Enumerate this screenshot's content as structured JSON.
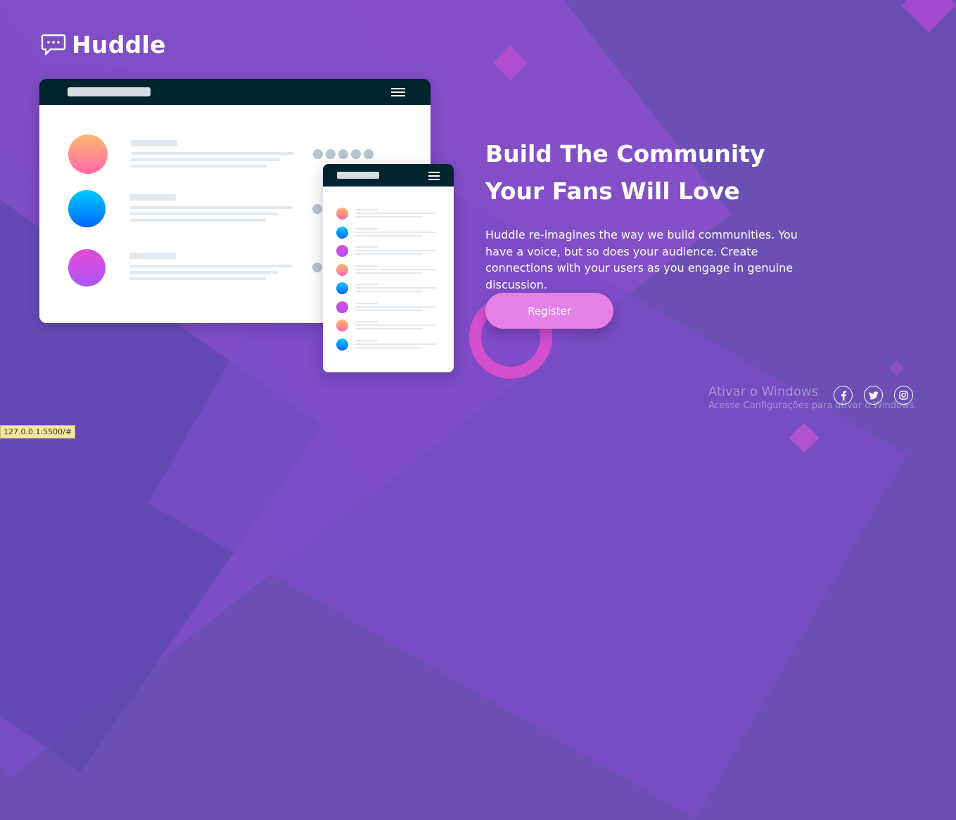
{
  "brand": {
    "name": "Huddle",
    "logo_icon": "chat-bubble-icon"
  },
  "hero": {
    "title_line1": "Build The Community",
    "title_line2": "Your Fans Will Love",
    "description": "Huddle re-imagines the way we build communities. You have a voice, but so does your audience. Create connections with your users as you engage in genuine discussion.",
    "cta_label": "Register"
  },
  "social": [
    {
      "name": "facebook-icon"
    },
    {
      "name": "twitter-icon"
    },
    {
      "name": "instagram-icon"
    }
  ],
  "watermark": {
    "line1": "Ativar o Windows",
    "line2": "Acesse Configurações para ativar o Windows."
  },
  "statusbar": {
    "url": "127.0.0.1:5500/#"
  },
  "colors": {
    "background": "#6B4FB4",
    "button": "#E581E6",
    "mock_bar": "#00252E"
  }
}
